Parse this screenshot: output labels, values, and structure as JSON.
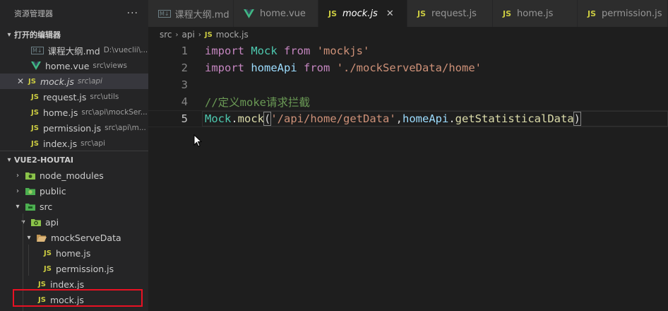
{
  "sidebar": {
    "header_title": "资源管理器",
    "more_icon": "···",
    "open_editors": {
      "title": "打开的编辑器",
      "items": [
        {
          "name": "课程大纲.md",
          "path": "D:\\vueclii\\...",
          "icon": "md"
        },
        {
          "name": "home.vue",
          "path": "src\\views",
          "icon": "vue"
        },
        {
          "name": "mock.js",
          "path": "src\\api",
          "icon": "js"
        },
        {
          "name": "request.js",
          "path": "src\\utils",
          "icon": "js"
        },
        {
          "name": "home.js",
          "path": "src\\api\\mockSer...",
          "icon": "js"
        },
        {
          "name": "permission.js",
          "path": "src\\api\\m...",
          "icon": "js"
        },
        {
          "name": "index.js",
          "path": "src\\api",
          "icon": "js"
        }
      ],
      "close_icon": "✕"
    },
    "project": {
      "title": "VUE2-HOUTAI",
      "tree": [
        {
          "name": "node_modules",
          "type": "folder"
        },
        {
          "name": "public",
          "type": "folder"
        },
        {
          "name": "src",
          "type": "folder"
        },
        {
          "name": "api",
          "type": "folder"
        },
        {
          "name": "mockServeData",
          "type": "folder"
        },
        {
          "name": "home.js",
          "type": "js"
        },
        {
          "name": "permission.js",
          "type": "js"
        },
        {
          "name": "index.js",
          "type": "js"
        },
        {
          "name": "mock.js",
          "type": "js"
        }
      ]
    },
    "js_badge": "JS",
    "md_badge": "M↓"
  },
  "tabs": [
    {
      "label": "课程大纲.md",
      "icon": "md"
    },
    {
      "label": "home.vue",
      "icon": "vue"
    },
    {
      "label": "mock.js",
      "icon": "js",
      "close": "✕"
    },
    {
      "label": "request.js",
      "icon": "js"
    },
    {
      "label": "home.js",
      "icon": "js"
    },
    {
      "label": "permission.js",
      "icon": "js"
    }
  ],
  "breadcrumb": {
    "parts": [
      "src",
      "api",
      "mock.js"
    ],
    "sep": "›"
  },
  "editor": {
    "line_numbers": [
      "1",
      "2",
      "3",
      "4",
      "5"
    ],
    "line1": {
      "kw1": "import",
      "name": "Mock",
      "kw2": "from",
      "str": "'mockjs'"
    },
    "line2": {
      "kw1": "import",
      "name": "homeApi",
      "kw2": "from",
      "str": "'./mockServeData/home'"
    },
    "line4": {
      "comment": "//定义moke请求拦截"
    },
    "line5": {
      "obj": "Mock",
      "dot1": ".",
      "method": "mock",
      "open": "(",
      "str": "'/api/home/getData'",
      "comma": ",",
      "obj2": "homeApi",
      "dot2": ".",
      "fn": "getStatisticalData",
      "close": ")"
    }
  },
  "colors": {
    "js": "#cbcb41",
    "vue": "#41b883",
    "highlight": "#e81123"
  }
}
